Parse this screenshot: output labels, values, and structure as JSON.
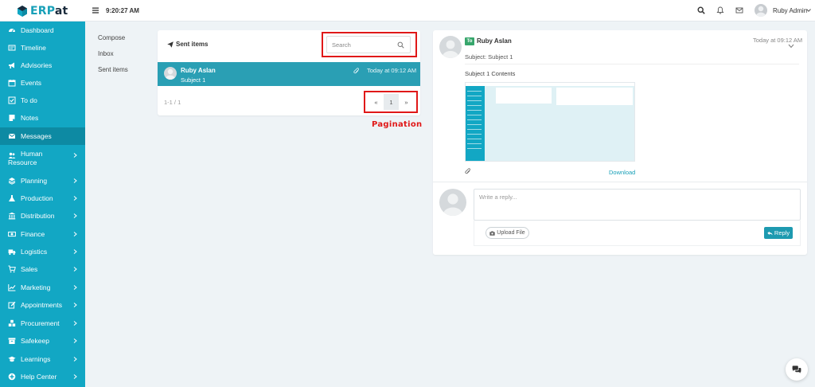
{
  "app": {
    "logo_text": "ERPat",
    "logo_accent": "ERP",
    "logo_rest": "at",
    "brand_color": "#12a7c4",
    "icon": "hexagon-logo"
  },
  "topbar": {
    "clock": "9:20:27 AM",
    "user_name": "Ruby Admin",
    "icons": [
      "search-icon",
      "bell-icon",
      "mail-icon",
      "avatar",
      "chevron-down-icon"
    ]
  },
  "sidebar": {
    "items": [
      {
        "label": "Dashboard",
        "icon": "dashboard-icon",
        "chevron": false
      },
      {
        "label": "Timeline",
        "icon": "timeline-icon",
        "chevron": false
      },
      {
        "label": "Advisories",
        "icon": "bullhorn-icon",
        "chevron": false
      },
      {
        "label": "Events",
        "icon": "calendar-icon",
        "chevron": false
      },
      {
        "label": "To do",
        "icon": "checkbox-icon",
        "chevron": false
      },
      {
        "label": "Notes",
        "icon": "note-icon",
        "chevron": false
      },
      {
        "label": "Messages",
        "icon": "envelope-icon",
        "chevron": false,
        "active": true
      },
      {
        "label": "Human",
        "label2": "Resource",
        "icon": "users-icon",
        "chevron": true
      },
      {
        "label": "Planning",
        "icon": "layers-icon",
        "chevron": true
      },
      {
        "label": "Production",
        "icon": "flask-icon",
        "chevron": true
      },
      {
        "label": "Distribution",
        "icon": "bank-icon",
        "chevron": true
      },
      {
        "label": "Finance",
        "icon": "money-icon",
        "chevron": true
      },
      {
        "label": "Logistics",
        "icon": "truck-icon",
        "chevron": true
      },
      {
        "label": "Sales",
        "icon": "cart-icon",
        "chevron": true
      },
      {
        "label": "Marketing",
        "icon": "chart-icon",
        "chevron": true
      },
      {
        "label": "Appointments",
        "icon": "edit-icon",
        "chevron": true
      },
      {
        "label": "Procurement",
        "icon": "cubes-icon",
        "chevron": true
      },
      {
        "label": "Safekeep",
        "icon": "archive-icon",
        "chevron": true
      },
      {
        "label": "Learnings",
        "icon": "graduation-icon",
        "chevron": true
      },
      {
        "label": "Help Center",
        "icon": "plus-circle-icon",
        "chevron": true
      }
    ]
  },
  "subnav": {
    "items": [
      "Compose",
      "Inbox",
      "Sent items"
    ]
  },
  "list": {
    "title": "Sent items",
    "search_placeholder": "Search",
    "rows": [
      {
        "name": "Ruby Aslan",
        "subject": "Subject 1",
        "time": "Today at 09:12 AM"
      }
    ],
    "range": "1-1 / 1",
    "pager": {
      "prev": "«",
      "current": "1",
      "next": "»"
    }
  },
  "annotation": {
    "pagination_label": "Pagination",
    "color": "#e01818"
  },
  "detail": {
    "to_badge": "To",
    "sender": "Ruby Aslan",
    "time": "Today at 09:12 AM",
    "subject": "Subject: Subject 1",
    "contents": "Subject 1 Contents",
    "download": "Download",
    "reply_placeholder": "Write a reply...",
    "upload_label": "Upload File",
    "reply_label": "Reply"
  },
  "chat": {
    "icon": "chat-icon"
  }
}
